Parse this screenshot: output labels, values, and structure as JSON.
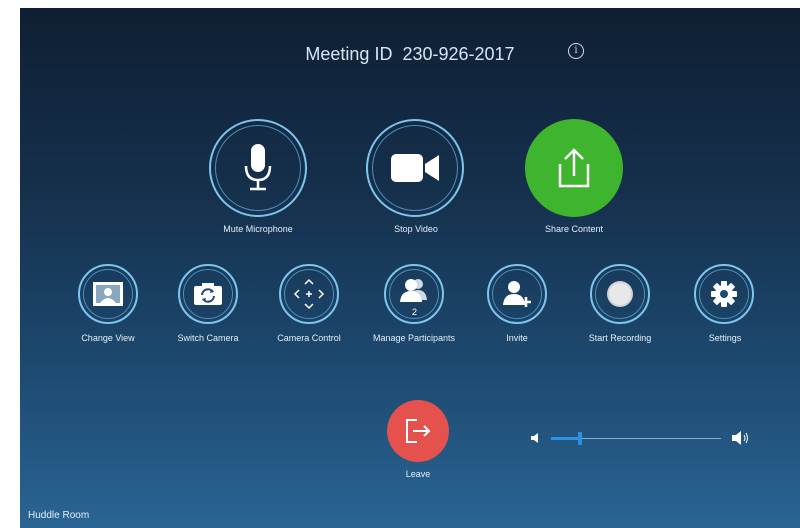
{
  "header": {
    "meeting_label": "Meeting ID",
    "meeting_id": "230-926-2017",
    "info_icon": "info-icon"
  },
  "primary_controls": [
    {
      "label": "Mute Microphone",
      "icon": "microphone-icon"
    },
    {
      "label": "Stop Video",
      "icon": "video-camera-icon"
    },
    {
      "label": "Share Content",
      "icon": "share-icon",
      "accent": "#3fb42e"
    }
  ],
  "secondary_controls": [
    {
      "label": "Change View",
      "icon": "gallery-view-icon"
    },
    {
      "label": "Switch Camera",
      "icon": "switch-camera-icon"
    },
    {
      "label": "Camera Control",
      "icon": "camera-control-icon"
    },
    {
      "label": "Manage Participants",
      "icon": "participants-icon",
      "count": "2"
    },
    {
      "label": "Invite",
      "icon": "invite-icon"
    },
    {
      "label": "Start Recording",
      "icon": "record-icon"
    },
    {
      "label": "Settings",
      "icon": "gear-icon"
    }
  ],
  "leave": {
    "label": "Leave",
    "icon": "leave-icon",
    "color": "#e5514d"
  },
  "volume": {
    "level": 0.17,
    "accent": "#2f8fe0"
  },
  "footer": {
    "room_name": "Huddle Room"
  }
}
